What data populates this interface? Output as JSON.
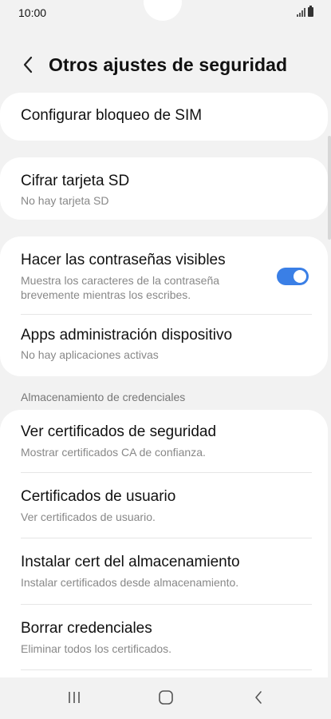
{
  "status_bar": {
    "time": "10:00"
  },
  "header": {
    "title": "Otros ajustes de seguridad",
    "back_icon": "chevron-left-icon"
  },
  "cards": {
    "sim": {
      "title": "Configurar bloqueo de SIM"
    },
    "sd": {
      "title": "Cifrar tarjeta SD",
      "subtitle": "No hay tarjeta SD"
    },
    "passwords": {
      "title": "Hacer las contraseñas visibles",
      "subtitle": "Muestra los caracteres de la contraseña brevemente mientras los escribes.",
      "toggle_on": true
    },
    "device_admin": {
      "title": "Apps administración dispositivo",
      "subtitle": "No hay aplicaciones activas"
    }
  },
  "credentials": {
    "section_title": "Almacenamiento de credenciales",
    "items": [
      {
        "title": "Ver certificados de seguridad",
        "subtitle": "Mostrar certificados CA de confianza."
      },
      {
        "title": "Certificados de usuario",
        "subtitle": "Ver certificados de usuario."
      },
      {
        "title": "Instalar cert del almacenamiento",
        "subtitle": "Instalar certificados desde almacenamiento."
      },
      {
        "title": "Borrar credenciales",
        "subtitle": "Eliminar todos los certificados."
      }
    ]
  },
  "colors": {
    "toggle_accent": "#3a7fe6",
    "background": "#f2f2f2",
    "card": "#ffffff"
  },
  "nav_bar": {
    "icons": [
      "recent-apps-icon",
      "home-icon",
      "back-icon"
    ]
  }
}
